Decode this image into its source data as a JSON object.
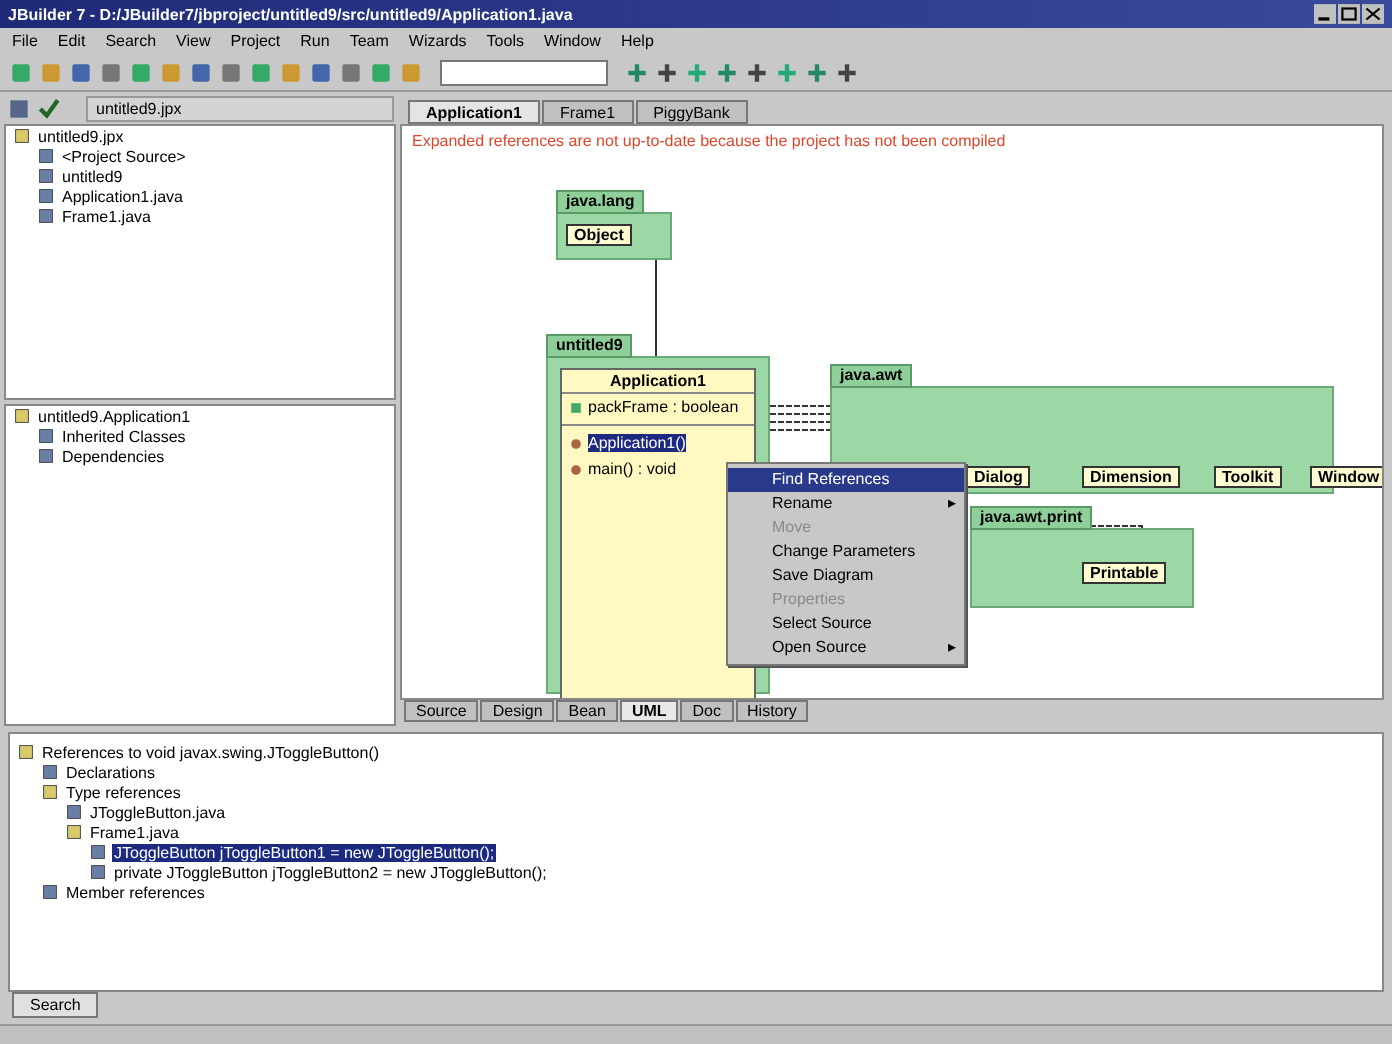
{
  "window": {
    "title": "JBuilder 7 - D:/JBuilder7/jbproject/untitled9/src/untitled9/Application1.java"
  },
  "menu": [
    "File",
    "Edit",
    "Search",
    "View",
    "Project",
    "Run",
    "Team",
    "Wizards",
    "Tools",
    "Window",
    "Help"
  ],
  "project_selector": {
    "value": "untitled9.jpx"
  },
  "project_tree": [
    {
      "label": "untitled9.jpx",
      "children": [
        {
          "label": "<Project Source>"
        },
        {
          "label": "untitled9"
        },
        {
          "label": "Application1.java"
        },
        {
          "label": "Frame1.java"
        }
      ]
    }
  ],
  "structure_tree": [
    {
      "label": "untitled9.Application1",
      "children": [
        {
          "label": "Inherited Classes"
        },
        {
          "label": "Dependencies"
        }
      ]
    }
  ],
  "editor_tabs": [
    {
      "label": "Application1",
      "selected": true
    },
    {
      "label": "Frame1",
      "selected": false
    },
    {
      "label": "PiggyBank",
      "selected": false
    }
  ],
  "diagram": {
    "notice": "Expanded references are not up-to-date because the project has not been compiled",
    "packages": [
      {
        "name": "java.lang",
        "classes": [
          "Object"
        ]
      },
      {
        "name": "untitled9"
      },
      {
        "name": "java.awt",
        "classes": [
          "Dialog",
          "Dimension",
          "Toolkit",
          "Window"
        ]
      },
      {
        "name": "java.awt.print",
        "classes": [
          "Printable"
        ]
      }
    ],
    "main_class": {
      "name": "Application1",
      "fields": [
        "packFrame : boolean"
      ],
      "methods": [
        {
          "label": "Application1()",
          "selected": true
        },
        {
          "label": "main() : void",
          "selected": false
        }
      ]
    }
  },
  "context_menu": [
    {
      "label": "Find References",
      "selected": true,
      "disabled": false
    },
    {
      "label": "Rename",
      "selected": false,
      "disabled": false,
      "shortcut": "▸"
    },
    {
      "label": "Move",
      "selected": false,
      "disabled": true
    },
    {
      "label": "Change Parameters",
      "selected": false,
      "disabled": false
    },
    {
      "label": "Save Diagram",
      "selected": false,
      "disabled": false
    },
    {
      "label": "Properties",
      "selected": false,
      "disabled": true
    },
    {
      "label": "Select Source",
      "selected": false,
      "disabled": false
    },
    {
      "label": "Open Source",
      "selected": false,
      "disabled": false,
      "shortcut": "▸"
    }
  ],
  "view_tabs": [
    {
      "label": "Source",
      "selected": false
    },
    {
      "label": "Design",
      "selected": false
    },
    {
      "label": "Bean",
      "selected": false
    },
    {
      "label": "UML",
      "selected": true
    },
    {
      "label": "Doc",
      "selected": false
    },
    {
      "label": "History",
      "selected": false
    }
  ],
  "search_results": [
    {
      "label": "References to void javax.swing.JToggleButton()",
      "selected": false,
      "children": [
        {
          "label": "Declarations",
          "selected": false
        },
        {
          "label": "Type references",
          "selected": false,
          "children": [
            {
              "label": "JToggleButton.java",
              "selected": false
            },
            {
              "label": "Frame1.java",
              "selected": false,
              "children": [
                {
                  "label": "JToggleButton jToggleButton1 = new JToggleButton();",
                  "selected": true
                },
                {
                  "label": "private JToggleButton jToggleButton2 = new JToggleButton();",
                  "selected": false
                }
              ]
            }
          ]
        },
        {
          "label": "Member references",
          "selected": false
        }
      ]
    }
  ],
  "bottom_tabs": [
    {
      "label": "Search",
      "selected": true
    }
  ]
}
